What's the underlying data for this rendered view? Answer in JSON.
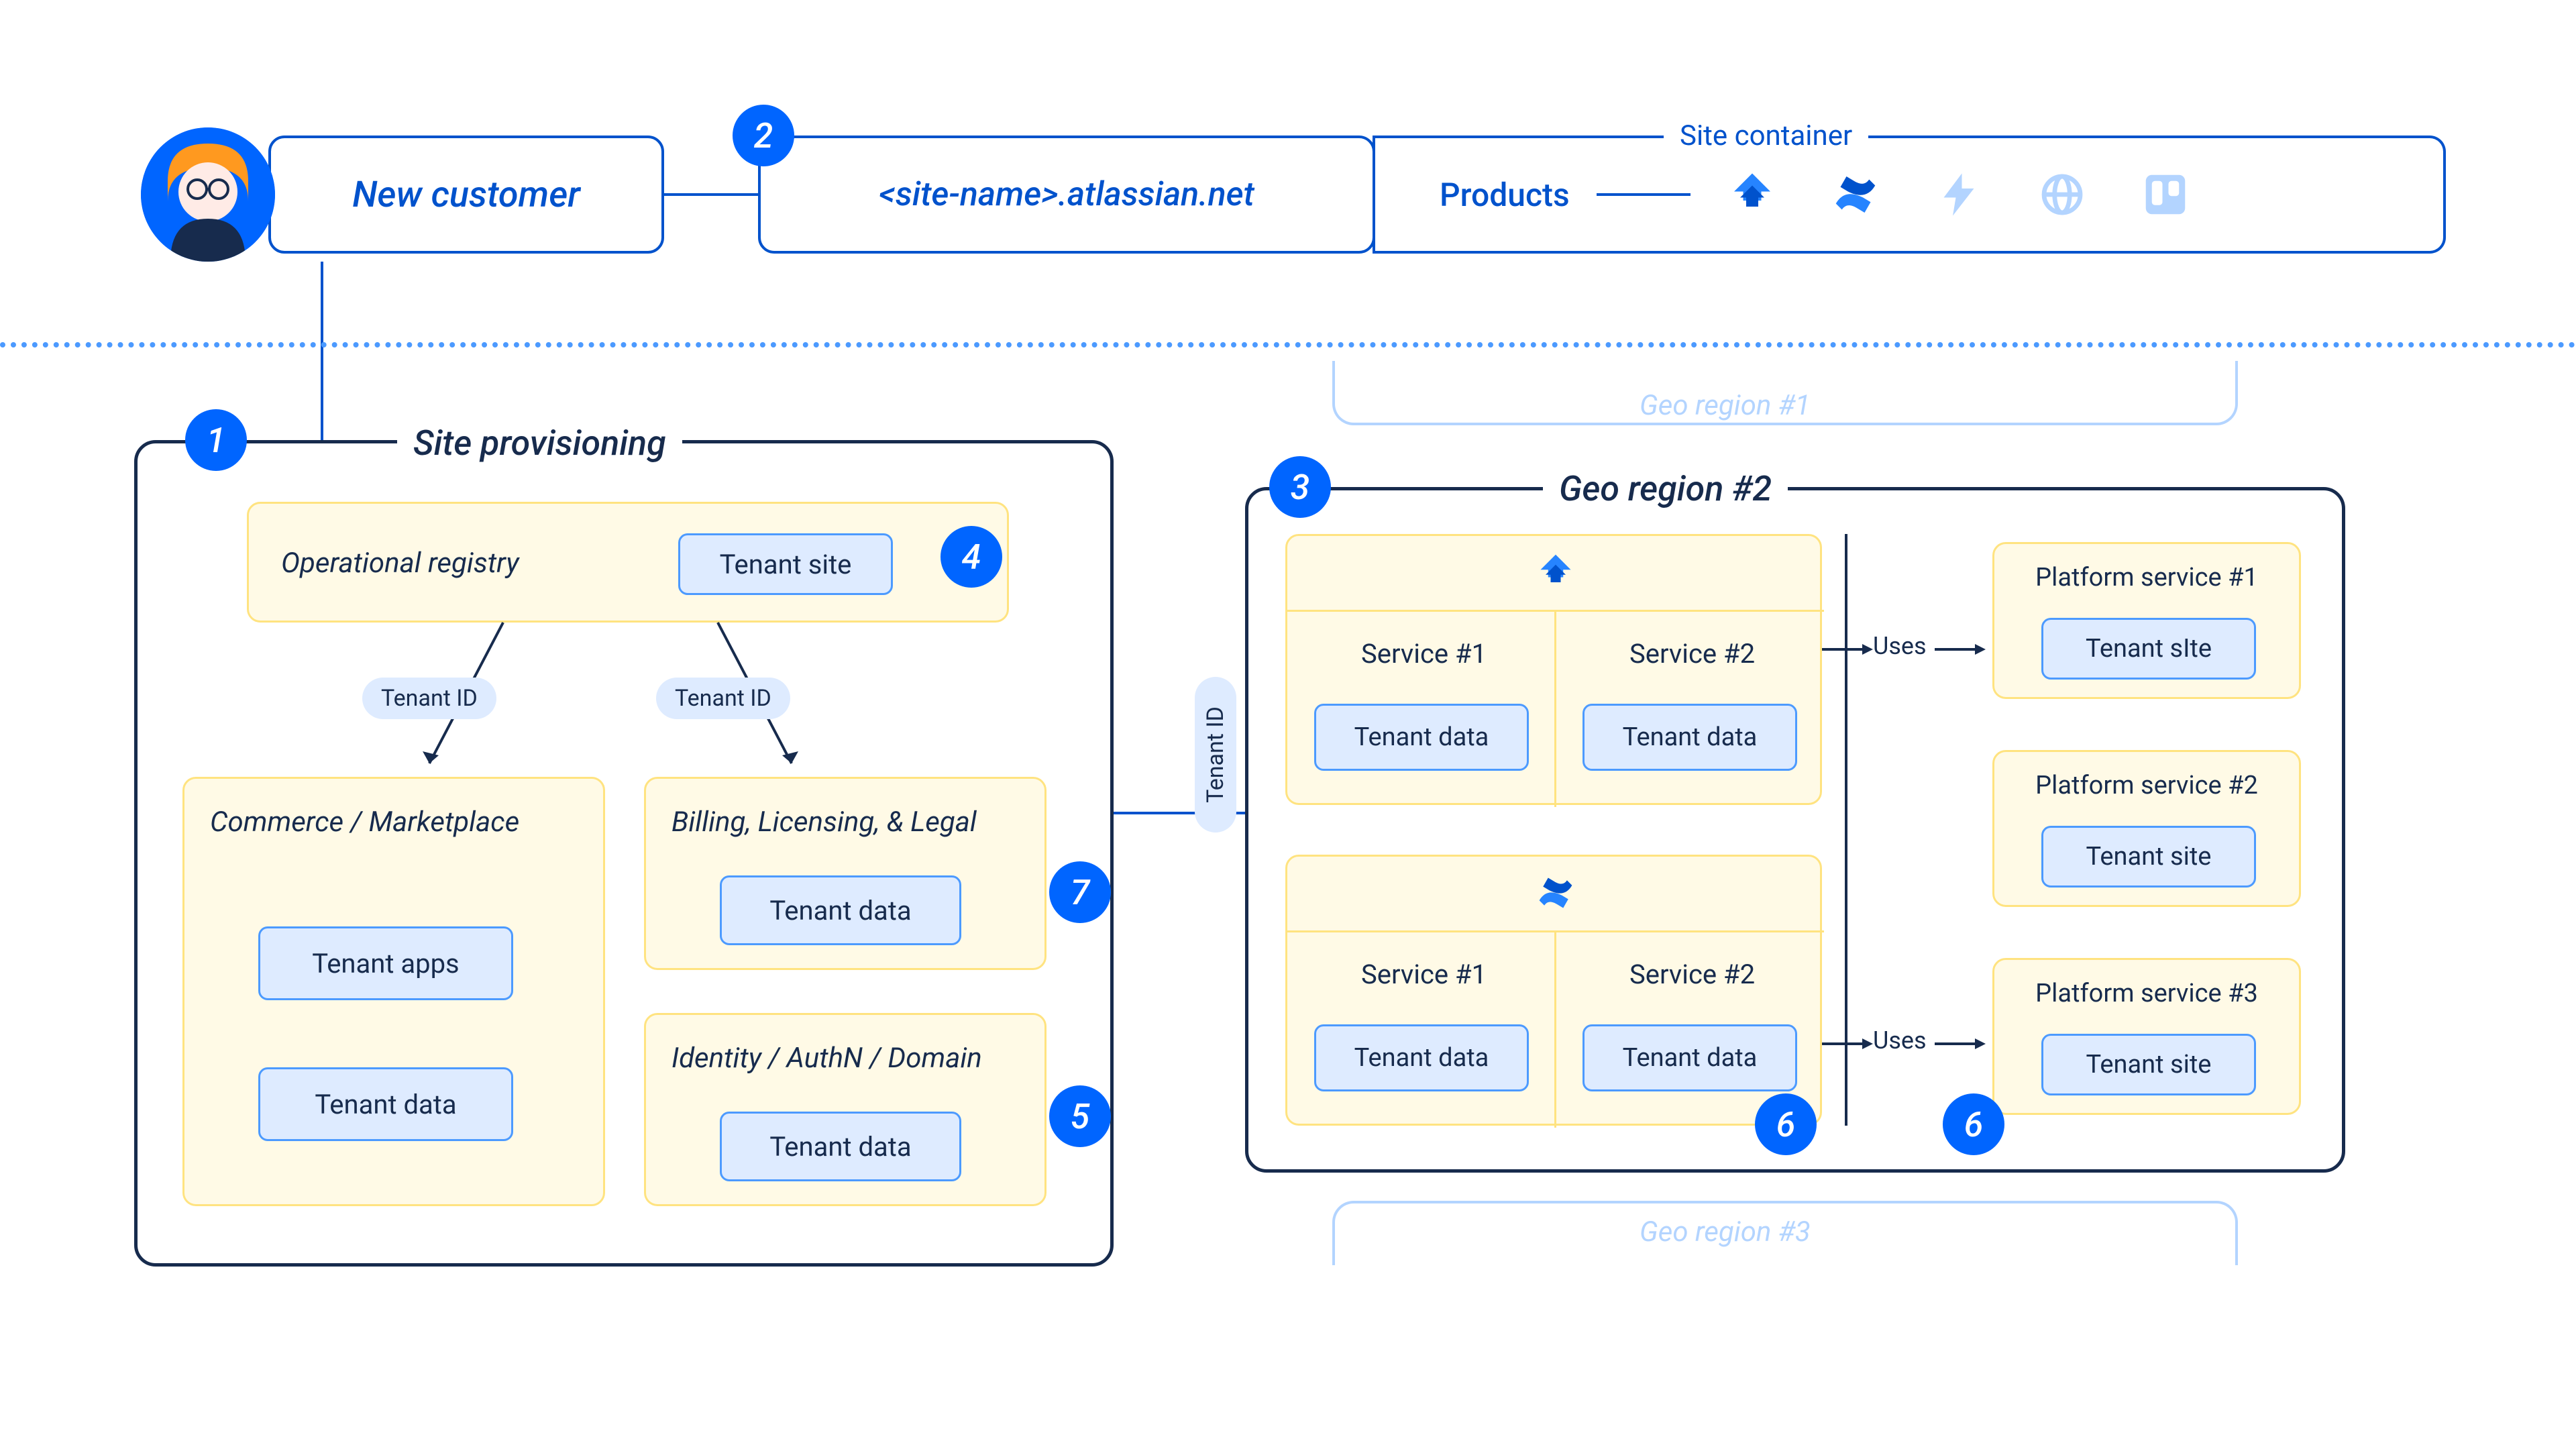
{
  "top": {
    "new_customer": "New customer",
    "site_name": "<site-name>.atlassian.net",
    "site_container": "Site container",
    "products": "Products"
  },
  "provisioning": {
    "title": "Site provisioning",
    "op_registry": "Operational registry",
    "tenant_site": "Tenant site",
    "tenant_id_1": "Tenant ID",
    "tenant_id_2": "Tenant ID",
    "tenant_id_3": "Tenant ID",
    "commerce_title": "Commerce / Marketplace",
    "tenant_apps": "Tenant apps",
    "tenant_data_1": "Tenant data",
    "billing_title": "Billing, Licensing, & Legal",
    "tenant_data_2": "Tenant data",
    "identity_title": "Identity / AuthN / Domain",
    "tenant_data_3": "Tenant data"
  },
  "geo": {
    "region1": "Geo region #1",
    "region2": "Geo region #2",
    "region3": "Geo region #3",
    "service1": "Service #1",
    "service2": "Service #2",
    "tenant_data": "Tenant data",
    "uses": "Uses",
    "ps1": "Platform service #1",
    "ps2": "Platform service #2",
    "ps3": "Platform service #3",
    "tenant_site1": "Tenant sIte",
    "tenant_site2": "Tenant site",
    "tenant_site3": "Tenant site"
  },
  "steps": {
    "s1": "1",
    "s2": "2",
    "s3": "3",
    "s4": "4",
    "s5": "5",
    "s6": "6",
    "s7": "7"
  }
}
